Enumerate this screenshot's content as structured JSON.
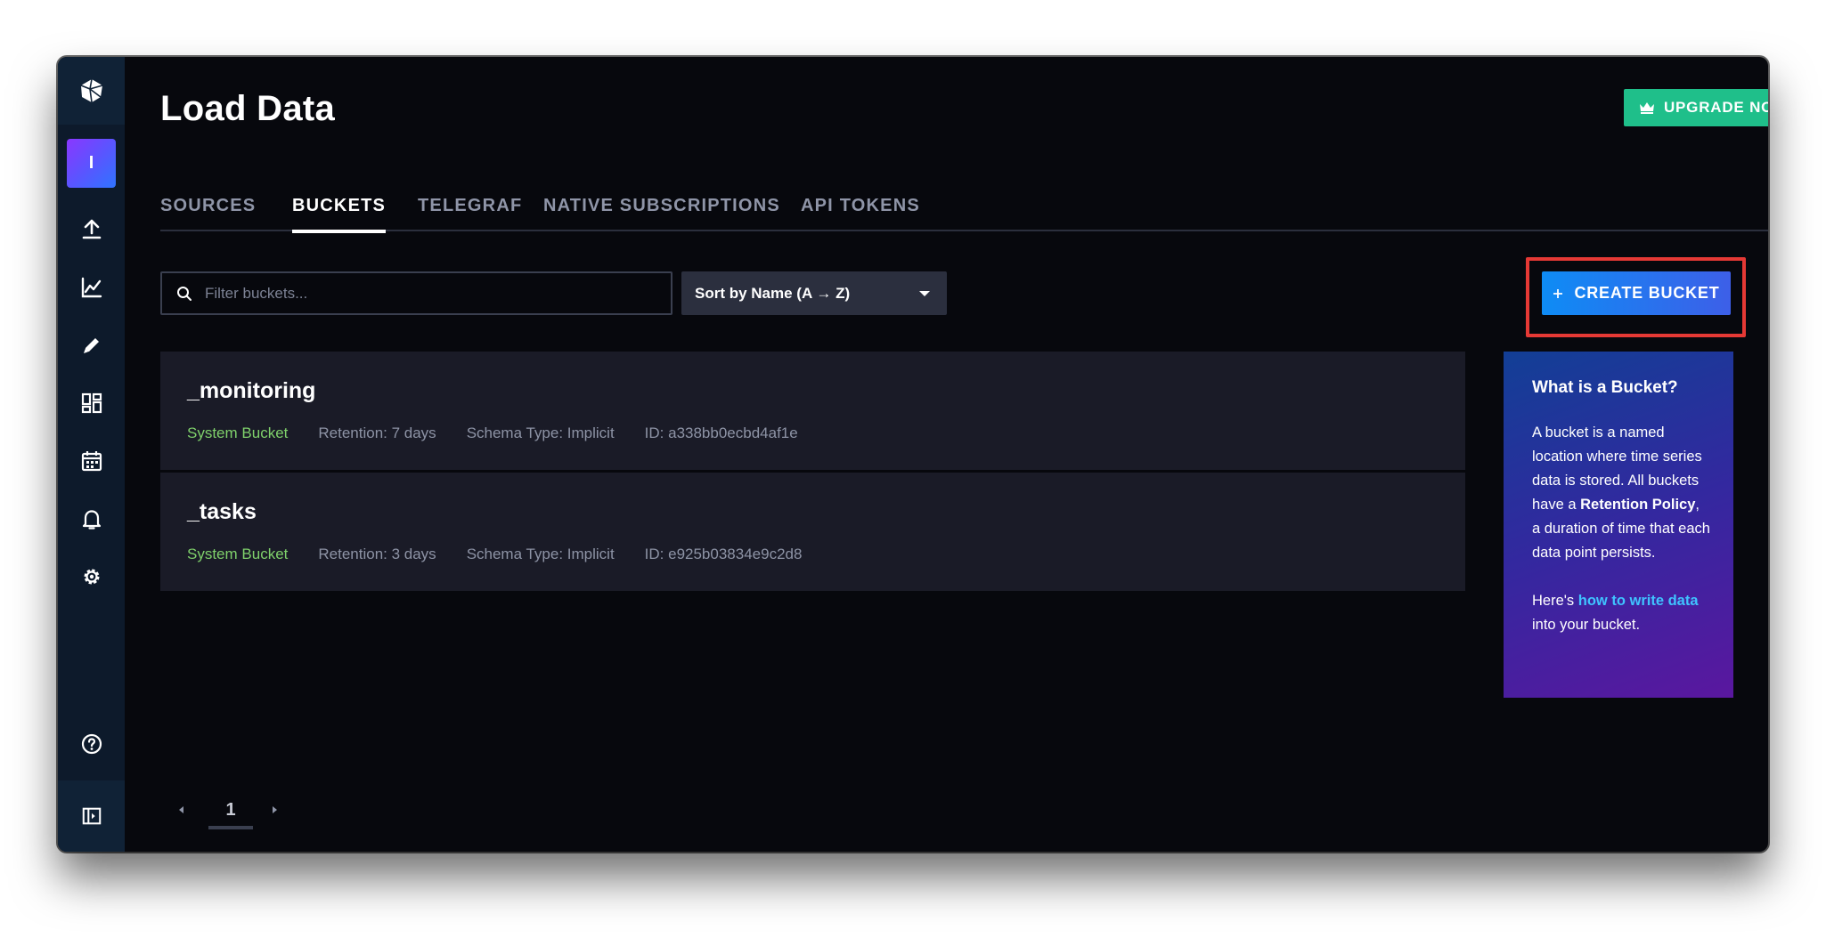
{
  "sidebar": {
    "logo_icon": "influx-cube-icon",
    "org_initial": "I",
    "nav_icons": [
      "upload-icon",
      "graph-icon",
      "pencil-icon",
      "dashboards-icon",
      "calendar-icon",
      "bell-icon",
      "gear-icon",
      "help-icon"
    ],
    "collapse_icon": "sidebar-toggle-icon"
  },
  "header": {
    "title": "Load Data",
    "upgrade_label": "UPGRADE NOW"
  },
  "tabs": [
    {
      "label": "SOURCES",
      "active": false
    },
    {
      "label": "BUCKETS",
      "active": true
    },
    {
      "label": "TELEGRAF",
      "active": false
    },
    {
      "label": "NATIVE SUBSCRIPTIONS",
      "active": false
    },
    {
      "label": "API TOKENS",
      "active": false
    }
  ],
  "toolbar": {
    "filter_placeholder": "Filter buckets...",
    "sort_label": "Sort by Name (A → Z)",
    "create_label": "CREATE BUCKET"
  },
  "buckets": [
    {
      "name": "_monitoring",
      "type": "System Bucket",
      "retention": "Retention: 7 days",
      "schema": "Schema Type: Implicit",
      "id": "ID: a338bb0ecbd4af1e"
    },
    {
      "name": "_tasks",
      "type": "System Bucket",
      "retention": "Retention: 3 days",
      "schema": "Schema Type: Implicit",
      "id": "ID: e925b03834e9c2d8"
    }
  ],
  "help": {
    "title": "What is a Bucket?",
    "p1_before": "A bucket is a named location where time series data is stored. All buckets have a ",
    "p1_bold": "Retention Policy",
    "p1_after": ", a duration of time that each data point persists.",
    "p2_before": "Here's ",
    "p2_link": "how to write data",
    "p2_after": " into your bucket."
  },
  "pagination": {
    "current_page": "1"
  },
  "colors": {
    "accent_blue": "#0e8cf5",
    "upgrade_green": "#1fbf8a",
    "system_bucket_green": "#7fd06b",
    "highlight_red": "#e53935"
  }
}
